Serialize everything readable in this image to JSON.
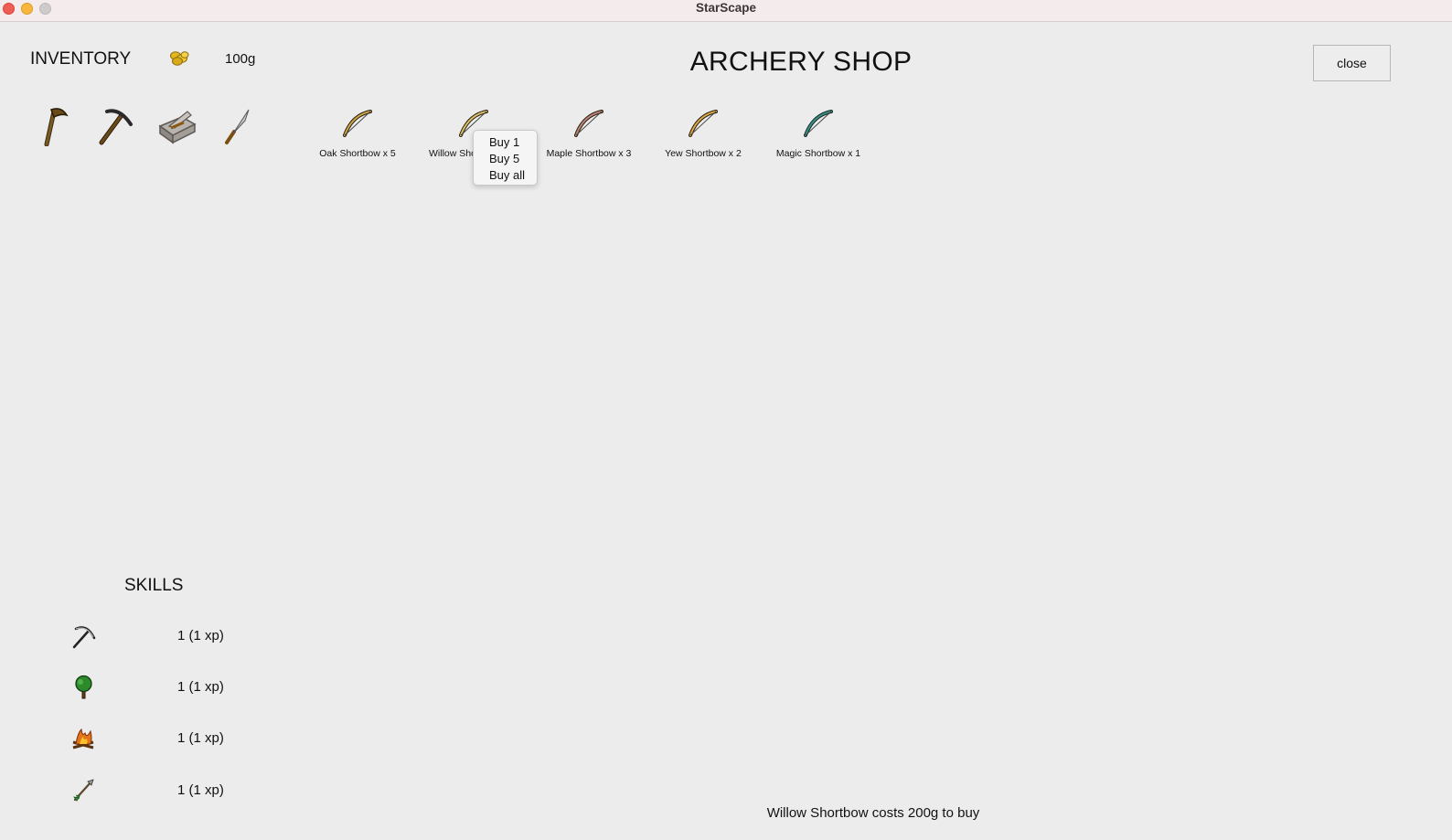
{
  "window": {
    "title": "StarScape"
  },
  "inventory": {
    "label": "INVENTORY",
    "gold": "100g",
    "items": [
      {
        "icon": "hatchet-icon"
      },
      {
        "icon": "pickaxe-icon"
      },
      {
        "icon": "tinderbox-icon"
      },
      {
        "icon": "knife-icon"
      }
    ]
  },
  "shop": {
    "title": "ARCHERY SHOP",
    "close_label": "close",
    "items": [
      {
        "label": "Oak Shortbow x 5",
        "color": "#c9a44a"
      },
      {
        "label": "Willow Shortbow",
        "color": "#d6c06a"
      },
      {
        "label": "Maple Shortbow x 3",
        "color": "#b9857f"
      },
      {
        "label": "Yew Shortbow x 2",
        "color": "#d8a84a"
      },
      {
        "label": "Magic Shortbow x 1",
        "color": "#3e8e84"
      }
    ]
  },
  "context_menu": {
    "items": [
      "Buy 1",
      "Buy 5",
      "Buy all"
    ]
  },
  "skills": {
    "label": "SKILLS",
    "rows": [
      {
        "icon": "mining-pickaxe-icon",
        "value": "1 (1 xp)"
      },
      {
        "icon": "woodcutting-tree-icon",
        "value": "1 (1 xp)"
      },
      {
        "icon": "firemaking-fire-icon",
        "value": "1 (1 xp)"
      },
      {
        "icon": "fletching-arrow-icon",
        "value": "1 (1 xp)"
      }
    ]
  },
  "status": "Willow Shortbow costs 200g to buy"
}
